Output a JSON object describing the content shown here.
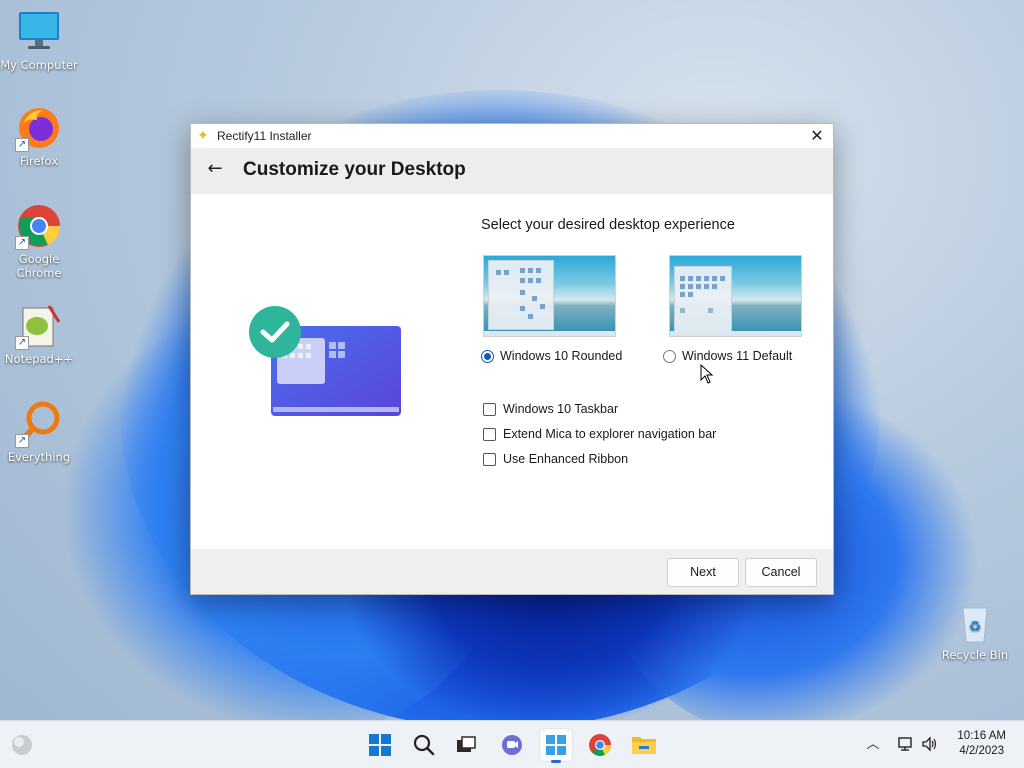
{
  "desktop": {
    "icons": [
      {
        "label": "My Computer",
        "icon": "monitor-icon"
      },
      {
        "label": "Firefox",
        "icon": "firefox-icon"
      },
      {
        "label": "Google Chrome",
        "icon": "chrome-icon"
      },
      {
        "label": "Notepad++",
        "icon": "notepadpp-icon"
      },
      {
        "label": "Everything",
        "icon": "everything-search-icon"
      },
      {
        "label": "Recycle Bin",
        "icon": "recycle-bin-icon"
      }
    ]
  },
  "dialog": {
    "window_title": "Rectify11 Installer",
    "close_glyph": "✕",
    "back_glyph": "←",
    "page_title": "Customize your Desktop",
    "section_title": "Select your desired desktop experience",
    "options": [
      {
        "label": "Windows 10 Rounded",
        "selected": true
      },
      {
        "label": "Windows 11 Default",
        "selected": false
      }
    ],
    "checkboxes": [
      {
        "label": "Windows 10 Taskbar",
        "checked": false
      },
      {
        "label": "Extend Mica to explorer navigation bar",
        "checked": false
      },
      {
        "label": "Use Enhanced Ribbon",
        "checked": false
      }
    ],
    "buttons": {
      "next": "Next",
      "cancel": "Cancel"
    },
    "accent_color": "#0a5cb8"
  },
  "taskbar": {
    "items": [
      "start-icon",
      "search-icon",
      "task-view-icon",
      "chat-icon",
      "rectify-installer-icon",
      "chrome-icon",
      "file-explorer-icon"
    ],
    "active_item": "rectify-installer-icon",
    "tray": {
      "time": "10:16 AM",
      "date": "4/2/2023"
    }
  }
}
